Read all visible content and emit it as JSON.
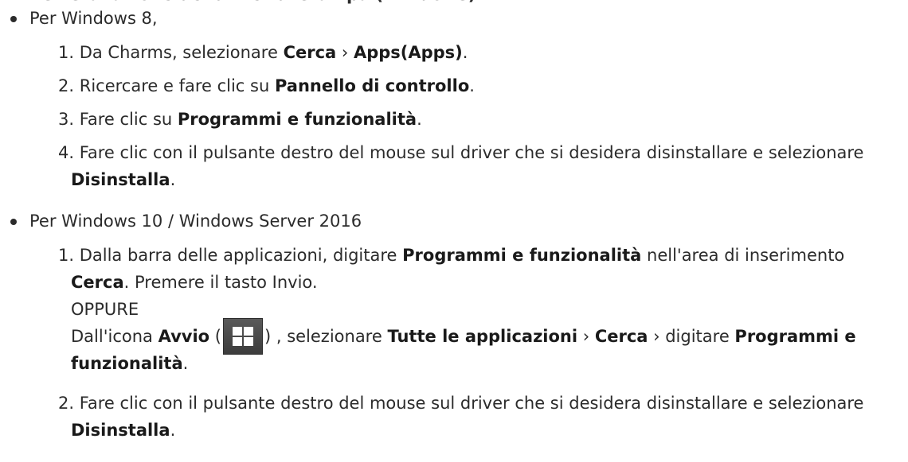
{
  "heading_fragment": "Disinstallazione del driver di stampa (Windows)",
  "bullets": [
    {
      "label": "Per Windows 8,",
      "steps": [
        {
          "num": "1.",
          "t1": " Da Charms, selezionare ",
          "b1": "Cerca",
          "t2": " › ",
          "b2": "Apps(Apps)",
          "t3": "."
        },
        {
          "num": "2.",
          "t1": " Ricercare e fare clic su ",
          "b1": "Pannello di controllo",
          "t2": "."
        },
        {
          "num": "3.",
          "t1": " Fare clic su ",
          "b1": "Programmi e funzionalità",
          "t2": "."
        },
        {
          "num": "4.",
          "t1": " Fare clic con il pulsante destro del mouse sul driver che si desidera disinstallare e selezionare ",
          "b1": "Disinstalla",
          "t2": "."
        }
      ]
    },
    {
      "label": "Per Windows 10 / Windows Server 2016",
      "steps": [
        {
          "num": "1.",
          "t1": " Dalla barra delle applicazioni, digitare ",
          "b1": "Programmi e funzionalità",
          "t2": " nell'area di inserimento ",
          "b2": "Cerca",
          "t3": ". Premere il tasto Invio.",
          "oppure": "OPPURE",
          "alt_t1": "Dall'icona ",
          "alt_b1": "Avvio",
          "alt_t2": " (",
          "alt_t3": ") , selezionare ",
          "alt_b2": "Tutte le applicazioni",
          "alt_t4": " › ",
          "alt_b3": "Cerca",
          "alt_t5": " › digitare ",
          "alt_b4": "Programmi e funzionalità",
          "alt_t6": "."
        },
        {
          "num": "2.",
          "t1": " Fare clic con il pulsante destro del mouse sul driver che si desidera disinstallare e selezionare ",
          "b1": "Disinstalla",
          "t2": "."
        }
      ]
    }
  ],
  "icons": {
    "start": "windows-start-icon"
  }
}
